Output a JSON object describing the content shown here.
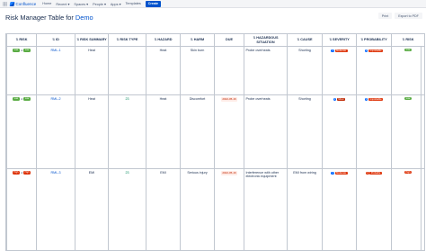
{
  "topbar": {
    "logo_text": "Confluence",
    "nav": [
      "Home",
      "Recent",
      "Spaces",
      "People",
      "Apps",
      "Templates"
    ],
    "create_label": "Create"
  },
  "header": {
    "title_prefix": "Risk Manager Table for",
    "title_link": "Demo",
    "print_label": "Print",
    "export_label": "Export to PDF"
  },
  "table": {
    "columns": [
      "Risk",
      "ID",
      "Risk Summary",
      "Risk Type",
      "Hazard",
      "Harm",
      "Due",
      "Hazardous Situation",
      "Cause",
      "Severity",
      "Probability",
      "Risk"
    ],
    "rows": [
      {
        "risk_before": "Low",
        "risk_after": "Low",
        "id": "RML-1",
        "summary": "Heat",
        "type": "",
        "hazard": "Heat",
        "harm": "Skin burn",
        "due": "",
        "situation": "Probe overheats",
        "cause": "Shorting",
        "severity_num": "1",
        "severity_label": "Moderate",
        "probability_num": "1",
        "probability_label": "Improbable",
        "risk_final": "Low"
      },
      {
        "risk_before": "Low",
        "risk_after": "Low",
        "id": "RML-2",
        "summary": "Heat",
        "type": "23",
        "hazard": "Heat",
        "harm": "Discomfort",
        "due": "2022-05-16",
        "situation": "Probe overheats",
        "cause": "Shorting",
        "severity_num": "1",
        "severity_label": "Minor",
        "probability_num": "1",
        "probability_label": "Improbable",
        "risk_final": "Low"
      },
      {
        "risk_before": "High",
        "risk_after": "High",
        "id": "RML-3",
        "summary": "EMI",
        "type": "23",
        "hazard": "EMI",
        "harm": "Serious injury",
        "due": "2022-05-16",
        "situation": "Interference with other electronic equipment",
        "cause": "EMI from wiring",
        "severity_num": "1",
        "severity_label": "Moderate",
        "probability_num": "1",
        "probability_label": "Probable",
        "risk_final": "High"
      }
    ]
  },
  "colors": {
    "accent": "#0052cc",
    "low": "#5aac44",
    "high": "#de350b"
  }
}
